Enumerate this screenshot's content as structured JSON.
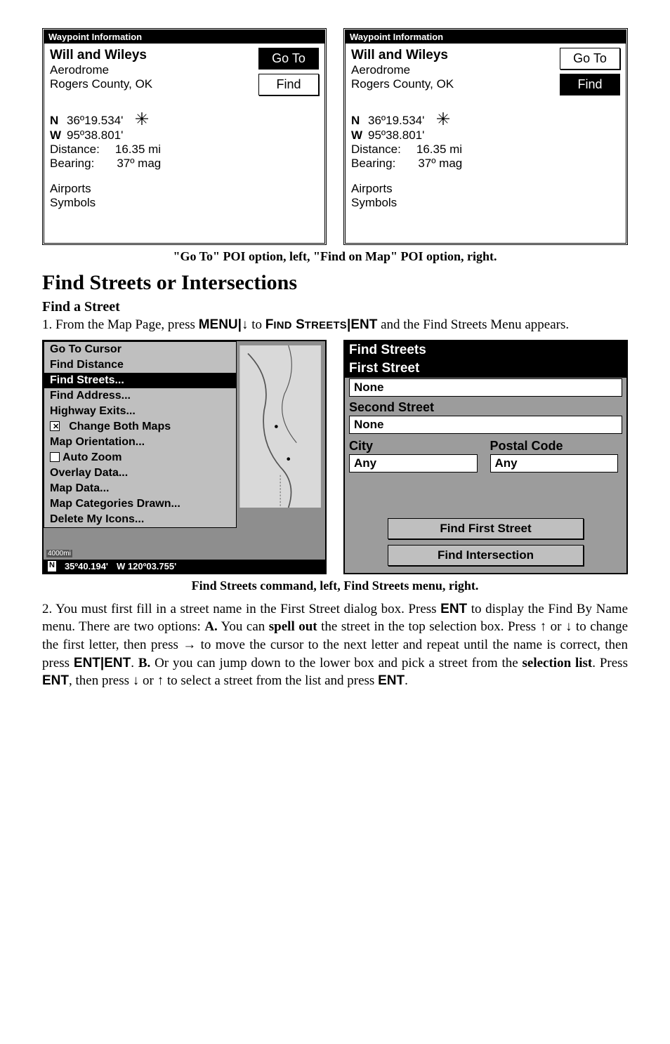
{
  "waypoint_panels": {
    "title": "Waypoint Information",
    "name": "Will and Wileys",
    "subtitle": "Aerodrome",
    "location": "Rogers County, OK",
    "lat_dir": "N",
    "lat_val": "36º19.534'",
    "lon_dir": "W",
    "lon_val": "95º38.801'",
    "distance_label": "Distance:",
    "distance_val": "16.35 mi",
    "bearing_label": "Bearing:",
    "bearing_val": "37º mag",
    "line1": "Airports",
    "line2": "Symbols",
    "go_to_label": "Go To",
    "find_label": "Find"
  },
  "caption1": "\"Go To\" POI option, left, \"Find on Map\" POI option, right.",
  "heading": "Find Streets or Intersections",
  "subheading": "Find a Street",
  "para1_a": "1. From the Map Page, press ",
  "para1_menu": "MENU",
  "para1_b": "|",
  "para1_arrow": "↓",
  "para1_c": " to ",
  "para1_find1": "F",
  "para1_find2": "IND",
  "para1_find3": " S",
  "para1_find4": "TREETS",
  "para1_d": "|",
  "para1_ent": "ENT",
  "para1_e": " and the Find Streets Menu appears.",
  "map_menu": {
    "items": [
      "Go To Cursor",
      "Find Distance",
      "Find Streets...",
      "Find Address...",
      "Highway Exits...",
      "Change Both Maps",
      "Map Orientation...",
      "Auto Zoom",
      "Overlay Data...",
      "Map Data...",
      "Map Categories Drawn...",
      "Delete My Icons..."
    ],
    "selected_index": 2,
    "checked_on_index": 5,
    "checked_off_index": 7,
    "scale": "4000mi",
    "lat": "35º40.194'",
    "lon": "W 120º03.755'"
  },
  "find_streets": {
    "title": "Find Streets",
    "first_label": "First Street",
    "first_value": "None",
    "second_label": "Second Street",
    "second_value": "None",
    "city_label": "City",
    "postal_label": "Postal Code",
    "city_value": "Any",
    "postal_value": "Any",
    "btn1": "Find First Street",
    "btn2": "Find Intersection"
  },
  "caption2": "Find Streets command, left, Find Streets menu, right.",
  "para2": {
    "t1": "2. You must first fill in a street name in the First Street dialog box. Press ",
    "ent1": "ENT",
    "t2": " to display the Find By Name menu. There are two options: ",
    "a": "A.",
    "t3": " You can ",
    "spell": "spell out",
    "t4": " the street in the top selection box. Press ",
    "up1": "↑",
    "or1": " or ",
    "down1": "↓",
    "t5": " to change the first letter, then press ",
    "right": "→",
    "t6": " to move the cursor to the next letter and repeat until the name is correct, then press ",
    "ent2": "ENT",
    "bar2": "|",
    "ent3": "ENT",
    "t7": ". ",
    "b": "B.",
    "t8": " Or you can jump down to the lower box and pick a street from the ",
    "sel": "selection list",
    "t9": ". Press ",
    "ent4": "ENT",
    "t10": ", then press ",
    "down2": "↓",
    "or2": " or ",
    "up2": "↑",
    "t11": " to select a street from the list and press ",
    "ent5": "ENT",
    "t12": "."
  }
}
